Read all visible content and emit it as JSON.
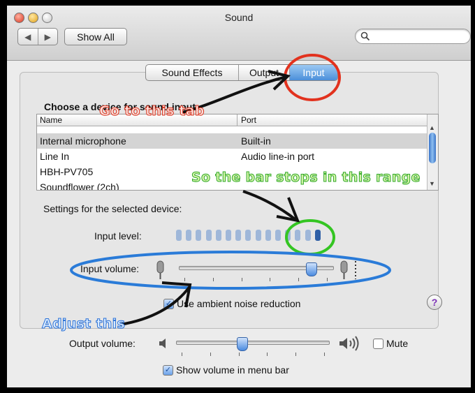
{
  "window": {
    "title": "Sound"
  },
  "toolbar": {
    "back": "◀",
    "forward": "▶",
    "show_all": "Show All",
    "search_value": ""
  },
  "tabs": [
    {
      "label": "Sound Effects",
      "selected": false
    },
    {
      "label": "Output",
      "selected": false
    },
    {
      "label": "Input",
      "selected": true
    }
  ],
  "device_section": {
    "heading": "Choose a device for sound input",
    "columns": [
      "Name",
      "Port"
    ],
    "rows": [
      {
        "name": "Internal microphone",
        "port": "Built-in",
        "selected": true
      },
      {
        "name": "Line In",
        "port": "Audio line-in port",
        "selected": false
      },
      {
        "name": "HBH-PV705",
        "port": "",
        "selected": false
      },
      {
        "name": "Soundflower (2ch)",
        "port": "",
        "selected": false
      }
    ]
  },
  "settings": {
    "heading": "Settings for the selected device:",
    "input_level_label": "Input level:",
    "input_level_segments": 15,
    "input_level_active": 1,
    "input_volume_label": "Input volume:",
    "input_volume_fraction": 0.86,
    "ambient_noise_label": "Use ambient noise reduction",
    "ambient_noise_checked": true
  },
  "output": {
    "volume_label": "Output volume:",
    "volume_fraction": 0.43,
    "mute_label": "Mute",
    "mute_checked": false,
    "show_in_menubar_label": "Show volume in menu bar",
    "show_in_menubar_checked": true
  },
  "help": "?",
  "annotations": {
    "tab": "Go to this tab",
    "range": "So the bar stops in this range",
    "adjust": "Adjust this"
  },
  "colors": {
    "red_annotation": "#d9321d",
    "green_annotation": "#31a82a",
    "blue_annotation": "#2a70d6",
    "accent": "#4b8fda"
  }
}
